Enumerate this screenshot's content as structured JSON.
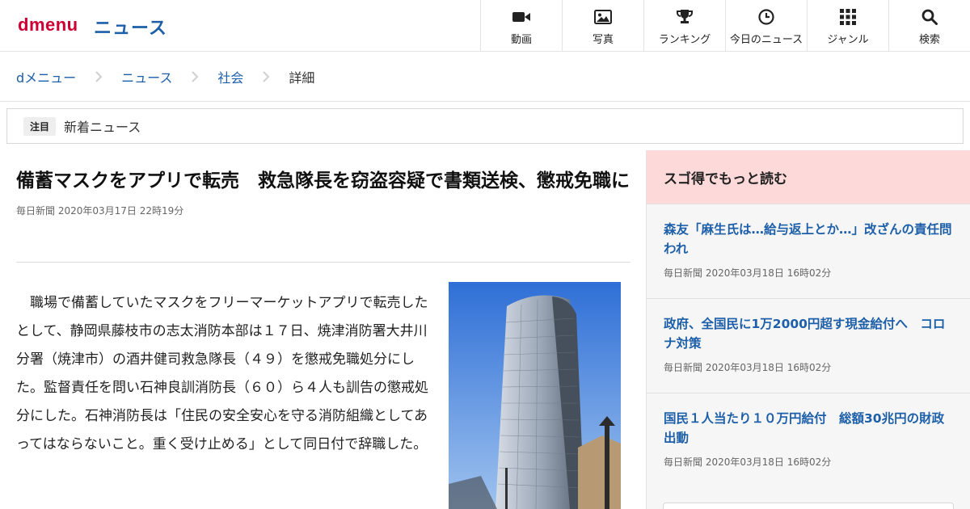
{
  "header": {
    "logo": "dmenu",
    "section": "ニュース",
    "nav": [
      {
        "label": "動画",
        "icon": "video-camera-icon"
      },
      {
        "label": "写真",
        "icon": "photo-icon"
      },
      {
        "label": "ランキング",
        "icon": "trophy-icon"
      },
      {
        "label": "今日のニュース",
        "icon": "clock-icon"
      },
      {
        "label": "ジャンル",
        "icon": "grid-icon"
      },
      {
        "label": "検索",
        "icon": "search-icon"
      }
    ]
  },
  "breadcrumb": {
    "items": [
      "dメニュー",
      "ニュース",
      "社会"
    ],
    "current": "詳細"
  },
  "notice": {
    "badge": "注目",
    "text": "新着ニュース"
  },
  "article": {
    "title": "備蓄マスクをアプリで転売　救急隊長を窃盗容疑で書類送検、懲戒免職に",
    "source": "毎日新聞",
    "datetime": "2020年03月17日 22時19分",
    "body": "職場で備蓄していたマスクをフリーマーケットアプリで転売したとして、静岡県藤枝市の志太消防本部は１７日、焼津消防署大井川分署（焼津市）の酒井健司救急隊長（４９）を懲戒免職処分にした。監督責任を問い石神良訓消防長（６０）ら４人も訓告の懲戒処分にした。石神消防長は「住民の安全安心を守る消防組織としてあってはならないこと。重く受け止める」として同日付で辞職した。"
  },
  "sidebar": {
    "heading": "スゴ得でもっと読む",
    "items": [
      {
        "title": "森友「麻生氏は…給与返上とか…」改ざんの責任問われ",
        "source": "毎日新聞",
        "datetime": "2020年03月18日 16時02分"
      },
      {
        "title": "政府、全国民に1万2000円超す現金給付へ　コロナ対策",
        "source": "毎日新聞",
        "datetime": "2020年03月18日 16時02分"
      },
      {
        "title": "国民１人当たり１０万円給付　総額30兆円の財政出動",
        "source": "毎日新聞",
        "datetime": "2020年03月18日 16時02分"
      }
    ]
  },
  "colors": {
    "brand": "#cc0033",
    "link": "#1d5fa8",
    "sidebar_head": "#fdd9d9"
  }
}
